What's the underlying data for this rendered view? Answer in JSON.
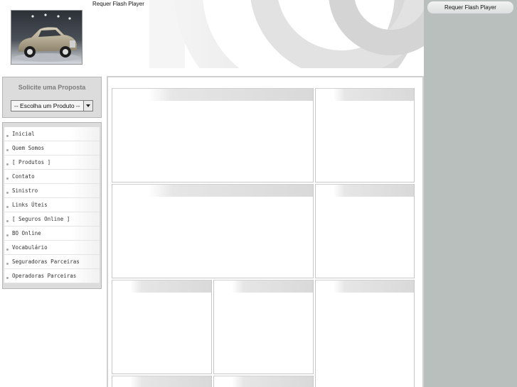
{
  "header": {
    "flash_notice": "Requer Flash Player",
    "logo_image": "classic-car-photo"
  },
  "right_column": {
    "flash_notice": "Requer Flash Player"
  },
  "quote_box": {
    "title": "Solicite uma Proposta",
    "select_value": "-- Escolha um Produto --"
  },
  "nav": {
    "items": [
      {
        "label": "Inicial"
      },
      {
        "label": "Quem Somos"
      },
      {
        "label": "[ Produtos ]"
      },
      {
        "label": "Contato"
      },
      {
        "label": "Sinistro"
      },
      {
        "label": "Links Úteis"
      },
      {
        "label": "[ Seguros Online ]"
      },
      {
        "label": "BO Online"
      },
      {
        "label": "Vocabulário"
      },
      {
        "label": "Seguradoras Parceiras"
      },
      {
        "label": "Operadoras Parceiras"
      }
    ]
  },
  "colors": {
    "sidebar_panel": "#dcdcdc",
    "right_column": "#b9bfbd",
    "heading_gray": "#7c7c7c"
  }
}
